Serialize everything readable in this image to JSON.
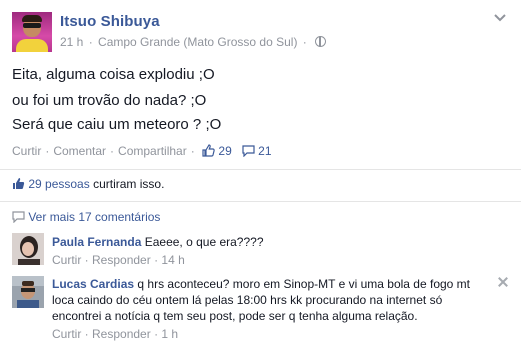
{
  "post": {
    "author": "Itsuo Shibuya",
    "time": "21 h",
    "location": "Campo Grande (Mato Grosso do Sul)",
    "lines": [
      "Eita, alguma coisa explodiu ;O",
      "ou foi um trovão do nada? ;O",
      "Será que caiu um meteoro ? ;O"
    ],
    "actions": {
      "like": "Curtir",
      "comment": "Comentar",
      "share": "Compartilhar",
      "like_count": "29",
      "comment_count": "21"
    },
    "likes_summary": {
      "people": "29 pessoas",
      "suffix": " curtiram isso."
    },
    "view_more": "Ver mais 17 comentários"
  },
  "comments": [
    {
      "author": "Paula Fernanda",
      "text": "Eaeee, o que era????",
      "like": "Curtir",
      "reply": "Responder",
      "time": "14 h"
    },
    {
      "author": "Lucas Cardias",
      "text_line1": "q hrs aconteceu? moro em Sinop-MT e vi uma bola de fogo mt",
      "text_line2": "loca caindo do céu ontem lá pelas 18:00 hrs kk procurando na internet só",
      "text_line3": "encontrei a notícia q tem seu post, pode ser q tenha alguma relação.",
      "like": "Curtir",
      "reply": "Responder",
      "time": "1 h"
    }
  ],
  "colors": {
    "link": "#3b5998",
    "muted": "#90949c",
    "text": "#141823"
  },
  "icons": [
    "globe-icon",
    "chevron-down-icon",
    "thumbs-up-icon",
    "comment-icon",
    "close-icon"
  ]
}
